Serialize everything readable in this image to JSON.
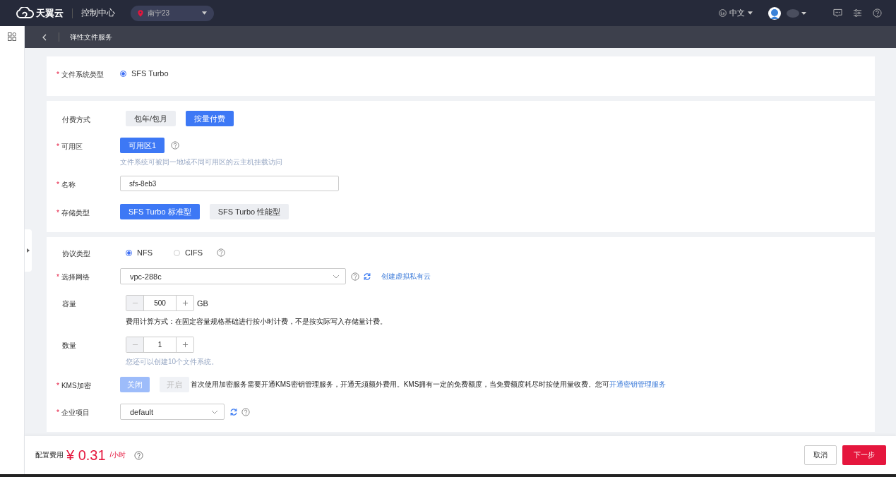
{
  "header": {
    "logo": "天翼云",
    "console": "控制中心",
    "region": "南宁23",
    "language": "中文"
  },
  "subheader": {
    "title": "弹性文件服务"
  },
  "sections": [
    {
      "rows": [
        {
          "kind": "radio",
          "label": "文件系统类型",
          "mark": "*",
          "options": [
            {
              "label": "SFS Turbo",
              "selected": true
            }
          ]
        }
      ]
    },
    {
      "rows": [
        {
          "kind": "segmented",
          "label": "付费方式",
          "options": [
            {
              "label": "包年/包月",
              "selected": false
            },
            {
              "label": "按量付费",
              "selected": true
            }
          ]
        },
        {
          "kind": "segmented",
          "label": "可用区",
          "mark": "*",
          "options": [
            {
              "label": "可用区1",
              "selected": true
            }
          ],
          "icons": [
            {
              "kind": "help"
            }
          ],
          "hint": "文件系统可被同一地域不同可用区的云主机挂载访问"
        },
        {
          "kind": "input",
          "label": "名称",
          "mark": "*",
          "value": "sfs-8eb3"
        },
        {
          "kind": "segmented",
          "label": "存储类型",
          "mark": "*",
          "options": [
            {
              "label": "SFS Turbo 标准型",
              "selected": true
            },
            {
              "label": "SFS Turbo 性能型",
              "selected": false
            }
          ]
        }
      ]
    },
    {
      "rows": [
        {
          "kind": "radio",
          "label": "协议类型",
          "options": [
            {
              "label": "NFS",
              "selected": true
            },
            {
              "label": "CIFS",
              "selected": false
            }
          ],
          "icons": [
            {
              "kind": "help"
            }
          ]
        },
        {
          "kind": "select",
          "label": "选择网络",
          "mark": "*",
          "value": "vpc-288c",
          "icons": [
            {
              "kind": "help"
            },
            {
              "kind": "refresh"
            }
          ],
          "link": "创建虚拟私有云"
        },
        {
          "kind": "stepper",
          "label": "容量",
          "value": "500",
          "unit": "GB",
          "note": "费用计算方式：在固定容量规格基础进行按小时计费，不是按实际写入存储量计费。"
        },
        {
          "kind": "stepper",
          "label": "数量",
          "value": "1",
          "hint": "您还可以创建10个文件系统。"
        },
        {
          "kind": "toggle",
          "label": "KMS加密",
          "mark": "*",
          "disabled": true,
          "options": [
            {
              "label": "关闭",
              "selected": true
            },
            {
              "label": "开启",
              "selected": false
            }
          ],
          "text": "首次使用加密服务需要开通KMS密钥管理服务，开通无须额外费用。KMS拥有一定的免费额度，当免费额度耗尽时按使用量收费。您可",
          "link": "开通密钥管理服务"
        },
        {
          "kind": "select",
          "label": "企业项目",
          "mark": "*",
          "value": "default",
          "small": true,
          "icons": [
            {
              "kind": "refresh"
            },
            {
              "kind": "help"
            }
          ]
        }
      ]
    }
  ],
  "footer": {
    "label": "配置费用",
    "price": "¥ 0.31",
    "unit": "/小时",
    "buttons": [
      {
        "label": "取消",
        "kind": "secondary"
      },
      {
        "label": "下一步",
        "kind": "primary"
      }
    ]
  }
}
